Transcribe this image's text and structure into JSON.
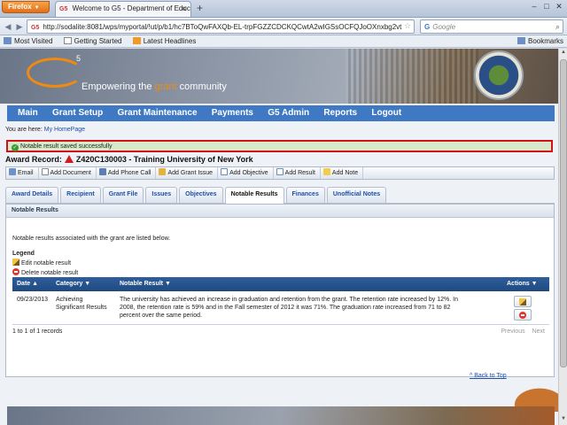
{
  "browser": {
    "app_button": "Firefox",
    "tab_title": "Welcome to G5 - Department of Educati...",
    "tab_favicon": "G5",
    "url": "http://sodalite:8081/wps/myportal/!ut/p/b1/hc7BToQwFAXQb-EL-trpFGZZCDCKQCwtA2wIGSsOCFQJoOXnxbg2vt",
    "search_placeholder": "Google",
    "bookmarks": [
      "Most Visited",
      "Getting Started",
      "Latest Headlines"
    ],
    "bookmarks_menu": "Bookmarks"
  },
  "banner": {
    "logo_superscript": "5",
    "tagline_before": "Empowering the ",
    "tagline_accent": "grant",
    "tagline_after": " community",
    "seal_name": "department-of-education-seal",
    "accent_color": "#f08a10"
  },
  "main_nav": [
    "Main",
    "Grant Setup",
    "Grant Maintenance",
    "Payments",
    "G5 Admin",
    "Reports",
    "Logout"
  ],
  "breadcrumb": {
    "prefix": "You are here:",
    "link": "My HomePage"
  },
  "notice": {
    "text": "Notable result saved successfully",
    "border_color": "#d0121b",
    "bg_color": "#d7e9c9"
  },
  "award": {
    "label": "Award Record:",
    "value": "Z420C130003 - Training University of New York"
  },
  "toolbar": [
    "Email",
    "Add Document",
    "Add Phone Call",
    "Add Grant Issue",
    "Add Objective",
    "Add Result",
    "Add Note"
  ],
  "page_tabs": [
    "Award Details",
    "Recipient",
    "Grant File",
    "Issues",
    "Objectives",
    "Notable Results",
    "Finances",
    "Unofficial Notes"
  ],
  "active_tab": "Notable Results",
  "panel": {
    "title": "Notable Results",
    "intro": "Notable results associated with the grant are listed below.",
    "legend_title": "Legend",
    "legend_edit": "Edit notable result",
    "legend_delete": "Delete notable result"
  },
  "table": {
    "headers": {
      "date": "Date ▲",
      "category": "Category ▼",
      "result": "Notable Result ▼",
      "actions": "Actions ▼"
    },
    "rows": [
      {
        "date": "09/23/2013",
        "category_line1": "Achieving",
        "category_line2": "Significant Results",
        "result_line1": "The university has achieved an increase in graduation and retention from the grant.  The retention rate increased by 12%.  In",
        "result_line2": "2008, the retention rate is 59% and in the Fall semester of 2012 it was 71%.  The graduation rate increased from 71 to 82",
        "result_line3": "percent over the same period."
      }
    ],
    "records": "1 to 1 of 1 records",
    "pager_prev": "Previous",
    "pager_next": "Next"
  },
  "back_to_top": "^ Back to Top"
}
